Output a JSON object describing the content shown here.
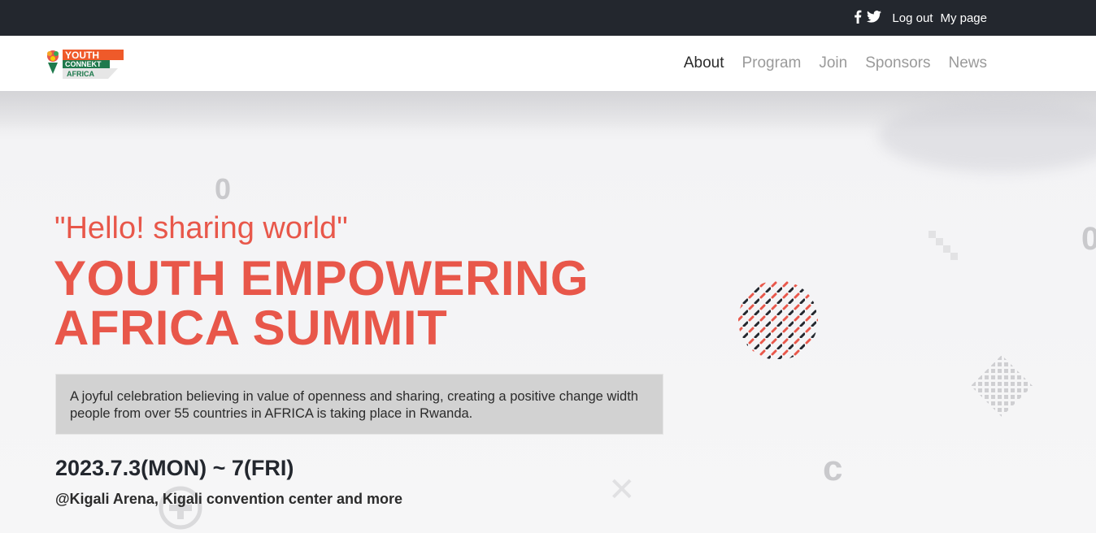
{
  "topbar": {
    "icons": [
      "facebook-icon",
      "twitter-icon"
    ],
    "logout_label": "Log out",
    "mypage_label": "My page"
  },
  "navbar": {
    "logo_text": {
      "line1": "YOUTH",
      "line2": "CONNEKT",
      "line3": "AFRICA"
    },
    "menu": [
      {
        "label": "About",
        "active": true
      },
      {
        "label": "Program",
        "active": false
      },
      {
        "label": "Join",
        "active": false
      },
      {
        "label": "Sponsors",
        "active": false
      },
      {
        "label": "News",
        "active": false
      }
    ]
  },
  "hero": {
    "tagline": "\"Hello! sharing world\"",
    "title_line1": "YOUTH EMPOWERING",
    "title_line2": "AFRICA SUMMIT",
    "description": "A joyful celebration believing in value of openness and sharing, creating a positive change width people from over 55 countries in AFRICA is taking place in Rwanda.",
    "date": "2023.7.3(MON) ~ 7(FRI)",
    "venue": "@Kigali Arena, Kigali convention center and more"
  },
  "colors": {
    "accent": "#e8574a",
    "topbar_bg": "#23272e",
    "dark_text": "#23272e",
    "muted_menu": "#9a9a9a"
  }
}
